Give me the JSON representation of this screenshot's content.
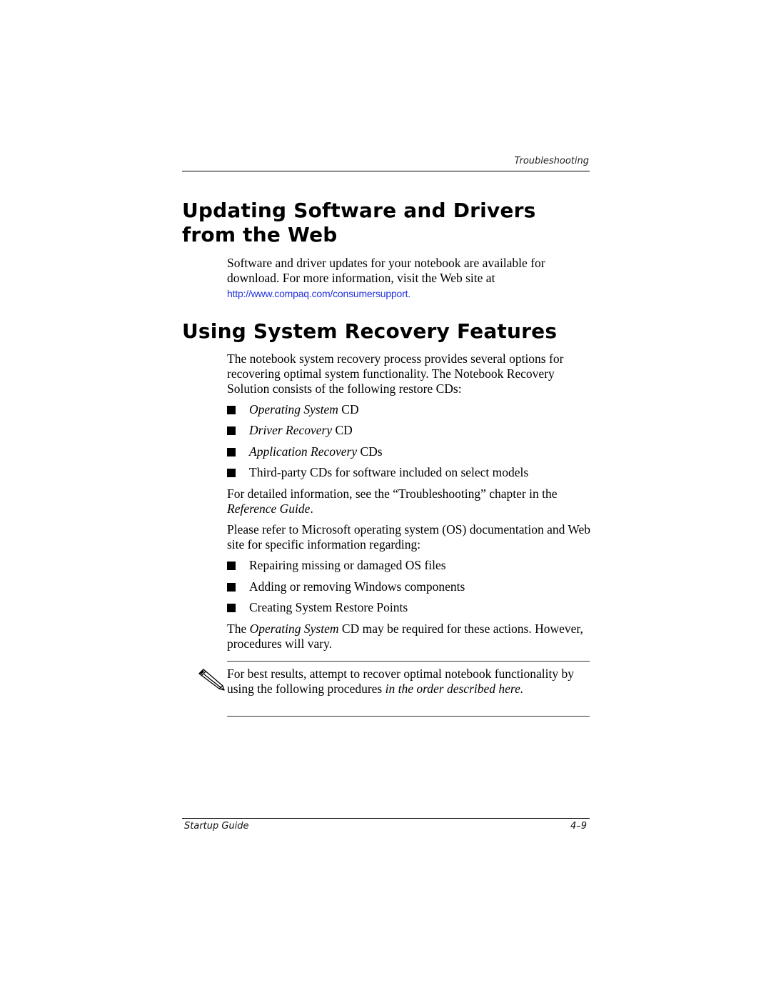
{
  "header": {
    "running_head": "Troubleshooting"
  },
  "section_update": {
    "title": "Updating Software and Drivers from the Web",
    "paragraph": "Software and driver updates for your notebook are available for download. For more information, visit the Web site at",
    "link_text": "http://www.compaq.com/consumersupport.",
    "link_color": "#2233dd"
  },
  "section_recovery": {
    "title": "Using System Recovery Features",
    "intro": "The notebook system recovery process provides several options for recovering optimal system functionality. The Notebook Recovery Solution consists of the following restore CDs:",
    "cd_list": [
      {
        "italic": "Operating System",
        "plain": " CD"
      },
      {
        "italic": "Driver Recovery",
        "plain": " CD"
      },
      {
        "italic": "Application Recovery",
        "plain": " CDs"
      },
      {
        "italic": "",
        "plain": "Third-party CDs for software included on select models"
      }
    ],
    "detail_para": {
      "before": "For detailed information, see the “Troubleshooting” chapter in the ",
      "italic": "Reference Guide",
      "after": "."
    },
    "microsoft_para": "Please refer to Microsoft operating system (OS) documentation and Web site for specific information regarding:",
    "os_list": [
      "Repairing missing or damaged OS files",
      "Adding or removing Windows components",
      "Creating System Restore Points"
    ],
    "os_cd_para": {
      "before": "The ",
      "italic": "Operating System",
      "after": " CD may be required for these actions. However, procedures will vary."
    },
    "note": {
      "icon": "pencil-note-icon",
      "plain": "For best results, attempt to recover optimal notebook functionality by using the following procedures ",
      "italic": "in the order described here."
    }
  },
  "footer": {
    "left": "Startup Guide",
    "page_number": "4–9"
  }
}
